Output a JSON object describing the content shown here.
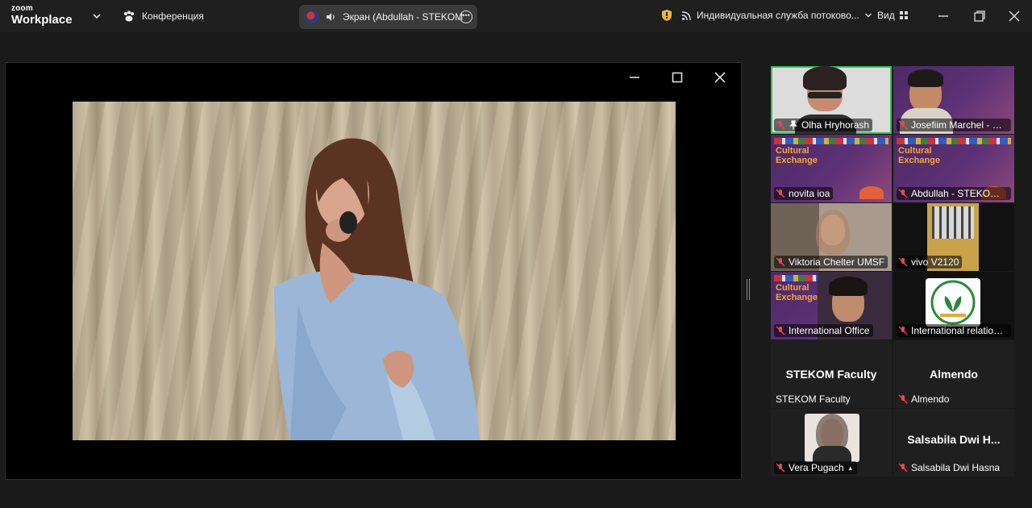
{
  "app": {
    "brand_small": "zoom",
    "brand_big": "Workplace",
    "meeting_label": "Конференция",
    "share_title": "Экран (Abdullah - STEKOM Uni",
    "stream_label": "Индивидуальная служба потоково...",
    "view_label": "Вид"
  },
  "participants": [
    {
      "name": "Olha Hryhorash",
      "muted": true,
      "pinned": true,
      "active": true
    },
    {
      "name": "Josefiim Marchel - St...",
      "muted": true
    },
    {
      "name": "novita ioa",
      "muted": true
    },
    {
      "name": "Abdullah - STEKOM ...",
      "muted": true
    },
    {
      "name": "Viktoria Chelter UMSF",
      "muted": true
    },
    {
      "name": "vivo V2120",
      "muted": true
    },
    {
      "name": "International Office",
      "muted": true
    },
    {
      "name": "International relations...",
      "muted": true
    },
    {
      "name": "STEKOM Faculty",
      "display": "STEKOM Faculty",
      "muted": false
    },
    {
      "name": "Almendo",
      "display": "Almendo",
      "muted": true
    },
    {
      "name": "Vera Pugach",
      "muted": true,
      "suffix": "▲"
    },
    {
      "name": "Salsabila Dwi Hasna",
      "display": "Salsabila  Dwi  H...",
      "muted": true
    }
  ],
  "poster_text": {
    "title_line1": "Cultural",
    "title_line2": "Exchange"
  },
  "colors": {
    "active_speaker": "#32c25a",
    "muted_icon": "#e5484d",
    "background": "#1a1a1a"
  }
}
